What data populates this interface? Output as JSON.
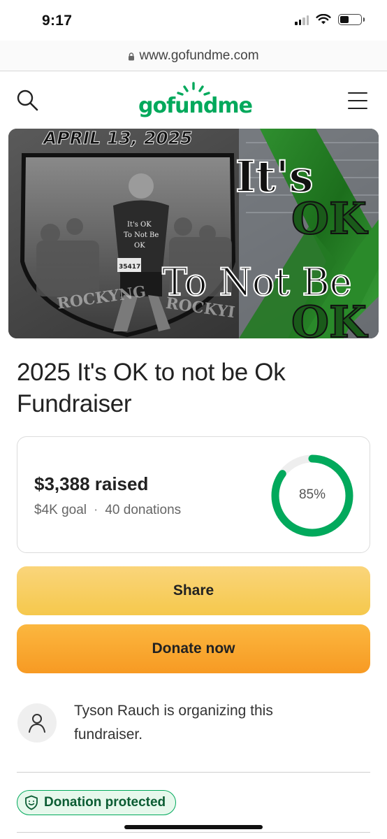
{
  "status_bar": {
    "time": "9:17"
  },
  "browser": {
    "url": "www.gofundme.com"
  },
  "header": {
    "logo_text": "gofundme",
    "brand_color": "#02a95c"
  },
  "hero": {
    "date_text": "APRIL 13, 2025",
    "line1": "It's",
    "line2": "OK",
    "line3": "To Not Be",
    "line4": "OK",
    "shirt_line1": "It's OK",
    "shirt_line2": "To Not Be",
    "shirt_line3": "OK",
    "bib_number": "35417",
    "shield_text_left": "ROCKYNG",
    "shield_text_right": "ROCKYI"
  },
  "campaign": {
    "title": "2025 It's OK to not be Ok Fundraiser"
  },
  "progress": {
    "raised": "$3,388 raised",
    "goal": "$4K goal",
    "separator": "·",
    "donations": "40 donations",
    "percent_label": "85%",
    "percent_value": 0.85,
    "progress_color": "#02a95c",
    "track_color": "#eeeeee"
  },
  "actions": {
    "share_label": "Share",
    "donate_label": "Donate now"
  },
  "organizer": {
    "text": "Tyson Rauch is organizing this fundraiser."
  },
  "badges": {
    "protected_label": "Donation protected"
  }
}
